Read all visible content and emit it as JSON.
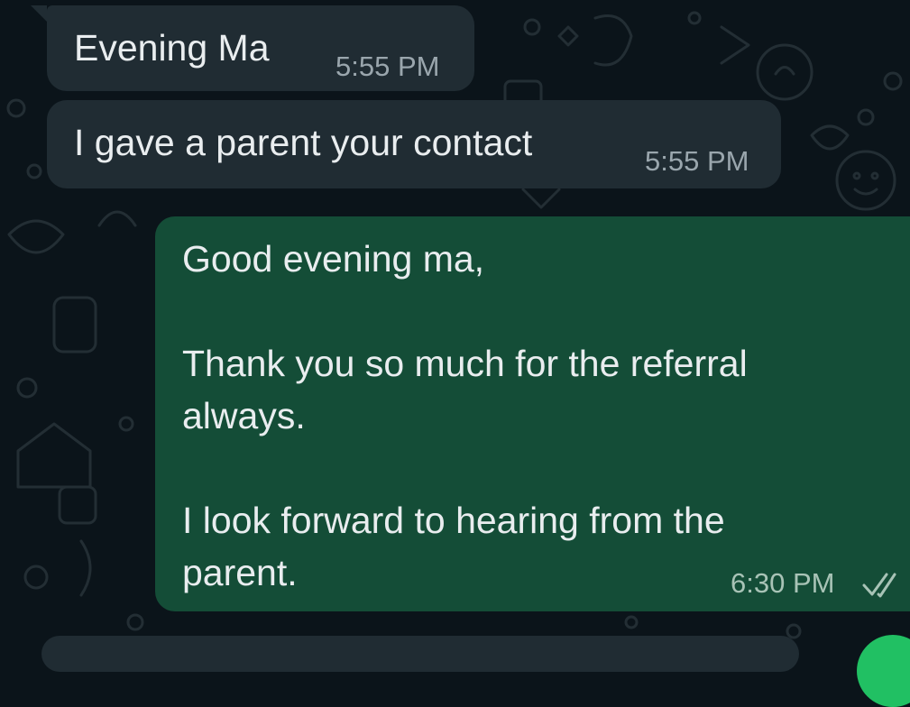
{
  "chat": {
    "messages": [
      {
        "direction": "incoming",
        "text": "Evening Ma",
        "time": "5:55 PM"
      },
      {
        "direction": "incoming",
        "text": "I gave a parent your contact",
        "time": "5:55 PM"
      },
      {
        "direction": "outgoing",
        "text": "Good evening ma,\n\nThank you so much for the referral\nalways.\n\nI look forward to hearing from the\nparent.",
        "time": "6:30 PM",
        "status": "read",
        "status_icon": "double-check-icon"
      }
    ]
  },
  "colors": {
    "background": "#0b141a",
    "incoming_bubble": "#202c33",
    "outgoing_bubble": "#144d37",
    "message_text": "#e9edef",
    "accent_green": "#21c063"
  }
}
